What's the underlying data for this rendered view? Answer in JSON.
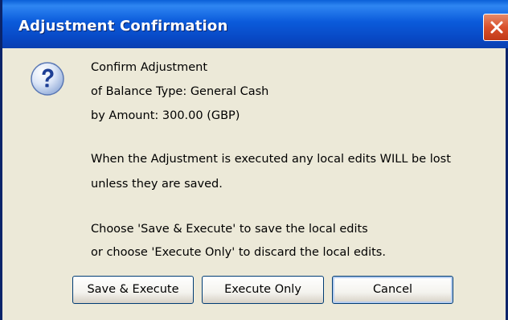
{
  "window": {
    "title": "Adjustment Confirmation",
    "close_icon": "close-icon"
  },
  "dialog": {
    "icon": "question-icon",
    "message_lines": [
      "Confirm Adjustment",
      "of Balance Type: General Cash",
      "by Amount: 300.00  (GBP)",
      "When the Adjustment is executed any local edits WILL be lost",
      "unless they are saved.",
      "Choose 'Save & Execute' to save the local edits",
      "or choose 'Execute Only' to discard the local edits."
    ]
  },
  "buttons": {
    "save_execute": "Save & Execute",
    "execute_only": "Execute Only",
    "cancel": "Cancel"
  },
  "colors": {
    "titlebar": "#0B5BDB",
    "dialog_bg": "#ECE9D8",
    "close_button": "#D9502C"
  }
}
